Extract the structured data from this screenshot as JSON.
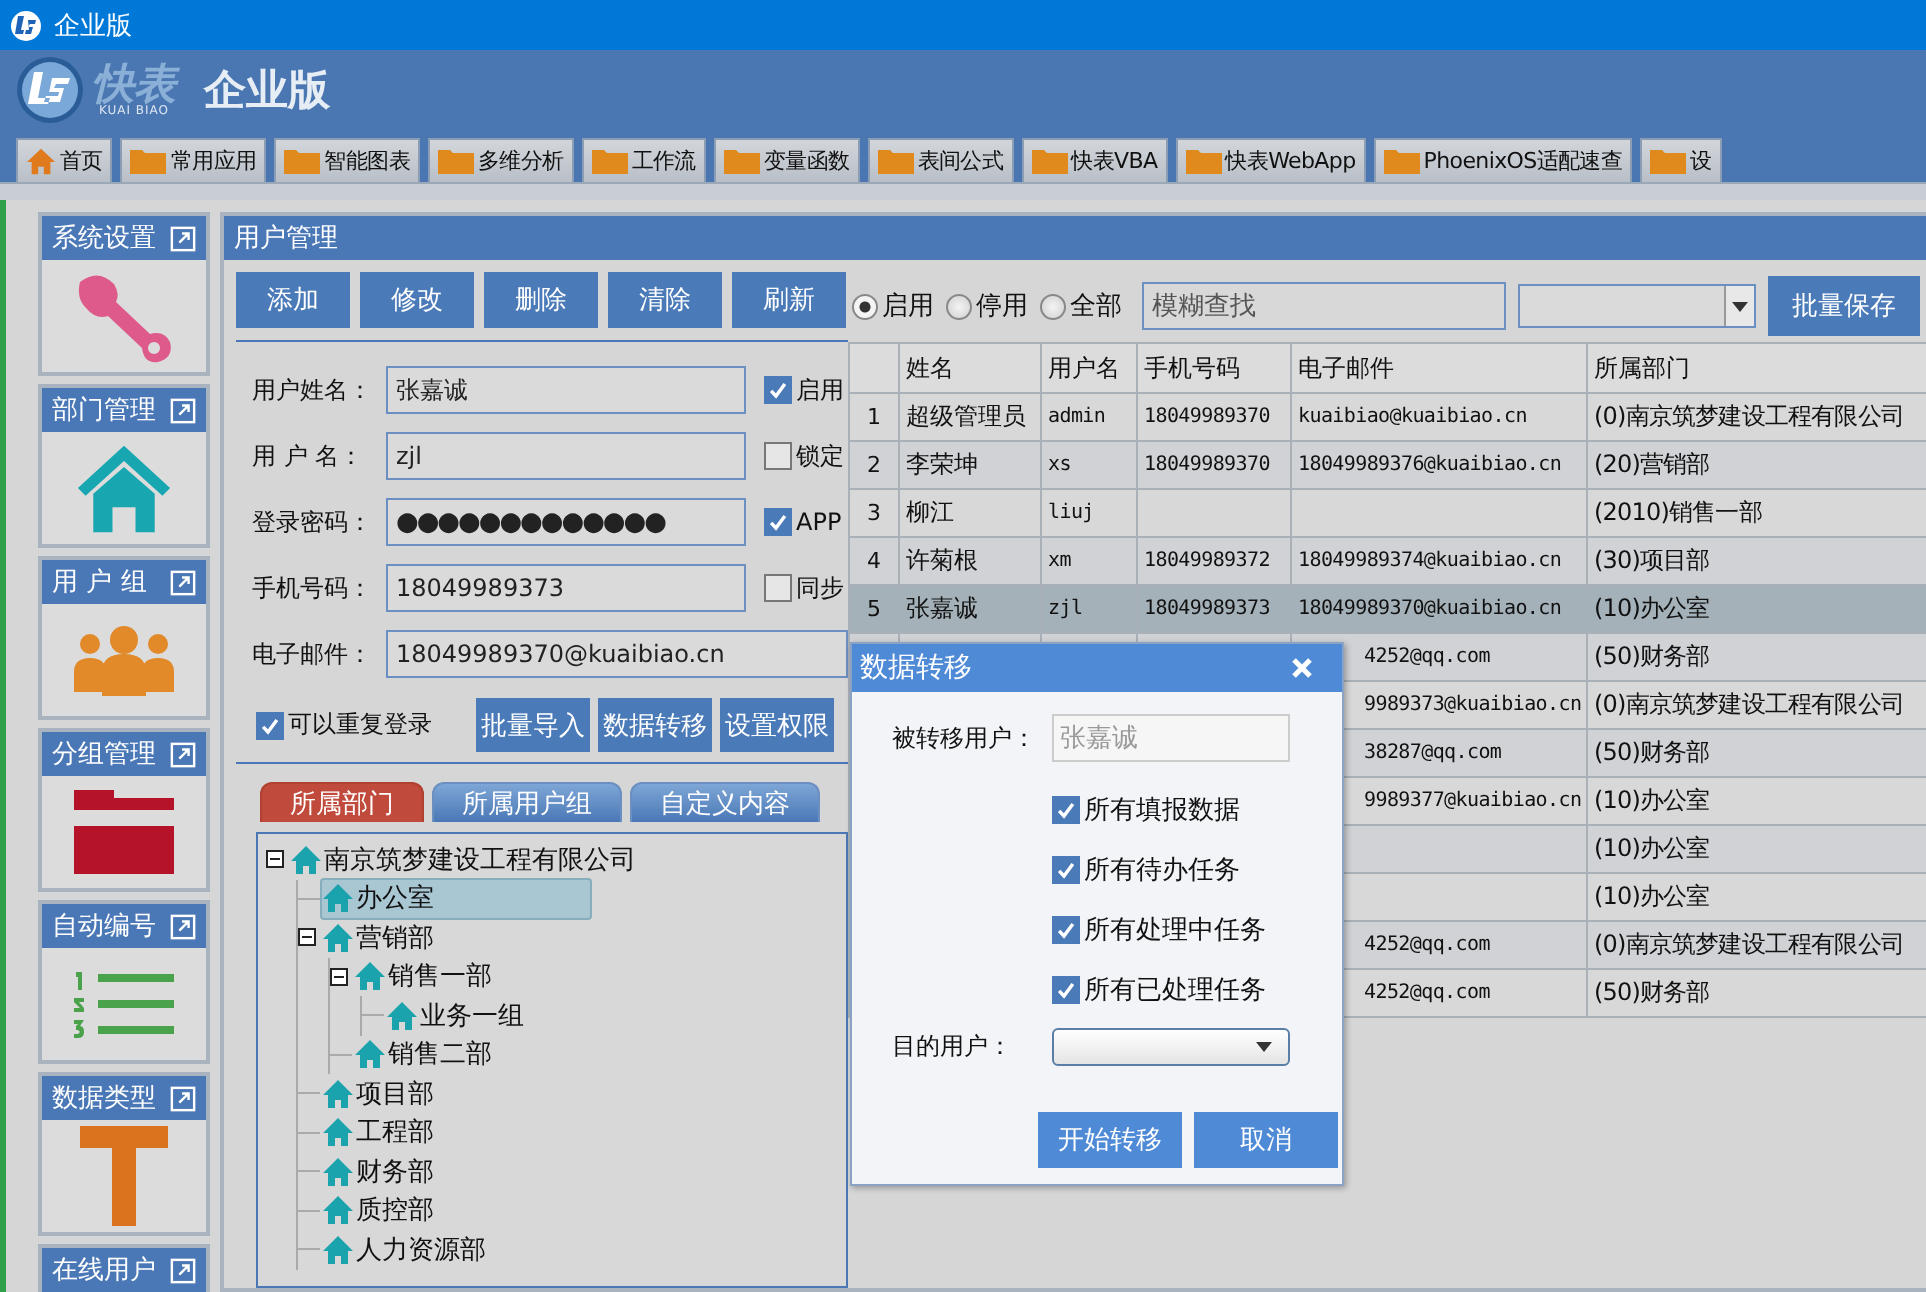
{
  "title_bar": {
    "title": "企业版"
  },
  "header": {
    "logo_text": "快表",
    "logo_subtext": "KUAI BIAO",
    "edition": "企业版"
  },
  "nav_tabs": [
    {
      "label": "首页",
      "kind": "home"
    },
    {
      "label": "常用应用",
      "kind": "folder"
    },
    {
      "label": "智能图表",
      "kind": "folder"
    },
    {
      "label": "多维分析",
      "kind": "folder"
    },
    {
      "label": "工作流",
      "kind": "folder"
    },
    {
      "label": "变量函数",
      "kind": "folder"
    },
    {
      "label": "表间公式",
      "kind": "folder"
    },
    {
      "label": "快表VBA",
      "kind": "folder"
    },
    {
      "label": "快表WebApp",
      "kind": "folder"
    },
    {
      "label": "PhoenixOS适配速查",
      "kind": "folder"
    },
    {
      "label": "设",
      "kind": "folder"
    }
  ],
  "sidebar": [
    {
      "title": "系统设置",
      "kind": "wrench"
    },
    {
      "title": "部门管理",
      "kind": "house"
    },
    {
      "title": "用 户 组",
      "kind": "people"
    },
    {
      "title": "分组管理",
      "kind": "folder"
    },
    {
      "title": "自动编号",
      "kind": "list"
    },
    {
      "title": "数据类型",
      "kind": "type"
    },
    {
      "title": "在线用户",
      "kind": "none"
    }
  ],
  "main": {
    "title": "用户管理",
    "toolbar": [
      "添加",
      "修改",
      "删除",
      "清除",
      "刷新"
    ],
    "fields": [
      {
        "label": "用户姓名：",
        "value": "张嘉诚",
        "option": {
          "label": "启用",
          "checked": true
        }
      },
      {
        "label": "用 户 名：",
        "value": "zjl",
        "option": {
          "label": "锁定",
          "checked": false
        }
      },
      {
        "label": "登录密码：",
        "value": "●●●●●●●●●●●●●",
        "option": {
          "label": "APP",
          "checked": true
        }
      },
      {
        "label": "手机号码：",
        "value": "18049989373",
        "option": {
          "label": "同步",
          "checked": false
        }
      },
      {
        "label": "电子邮件：",
        "value": "18049989370@kuaibiao.cn"
      }
    ],
    "repeat_login": {
      "label": "可以重复登录",
      "checked": true
    },
    "actions": [
      "批量导入",
      "数据转移",
      "设置权限"
    ],
    "tabs": [
      {
        "label": "所属部门",
        "selected": true
      },
      {
        "label": "所属用户组",
        "selected": false
      },
      {
        "label": "自定义内容",
        "selected": false
      }
    ],
    "tree": [
      {
        "label": "南京筑梦建设工程有限公司",
        "selected": false,
        "expanded": true,
        "children": [
          {
            "label": "办公室",
            "selected": true
          },
          {
            "label": "营销部",
            "selected": false,
            "expanded": true,
            "children": [
              {
                "label": "销售一部",
                "selected": false,
                "expanded": true,
                "children": [
                  {
                    "label": "业务一组",
                    "selected": false
                  }
                ]
              },
              {
                "label": "销售二部",
                "selected": false
              }
            ]
          },
          {
            "label": "项目部",
            "selected": false
          },
          {
            "label": "工程部",
            "selected": false
          },
          {
            "label": "财务部",
            "selected": false
          },
          {
            "label": "质控部",
            "selected": false
          },
          {
            "label": "人力资源部",
            "selected": false
          }
        ]
      }
    ]
  },
  "filter": {
    "radios": [
      {
        "label": "启用",
        "selected": true
      },
      {
        "label": "停用",
        "selected": false
      },
      {
        "label": "全部",
        "selected": false
      }
    ],
    "search": {
      "placeholder": "模糊查找"
    },
    "save_button": "批量保存"
  },
  "table": {
    "columns": [
      "姓名",
      "用户名",
      "手机号码",
      "电子邮件",
      "所属部门"
    ],
    "rows": [
      {
        "num": "1",
        "name": "超级管理员",
        "username": "admin",
        "phone": "18049989370",
        "email": "kuaibiao@kuaibiao.cn",
        "dept": "(0)南京筑梦建设工程有限公司",
        "selected": false
      },
      {
        "num": "2",
        "name": "李荣坤",
        "username": "xs",
        "phone": "18049989370",
        "email": "18049989376@kuaibiao.cn",
        "dept": "(20)营销部",
        "selected": false
      },
      {
        "num": "3",
        "name": "柳江",
        "username": "liuj",
        "phone": "",
        "email": "",
        "dept": "(2010)销售一部",
        "selected": false
      },
      {
        "num": "4",
        "name": "许菊根",
        "username": "xm",
        "phone": "18049989372",
        "email": "18049989374@kuaibiao.cn",
        "dept": "(30)项目部",
        "selected": false
      },
      {
        "num": "5",
        "name": "张嘉诚",
        "username": "zjl",
        "phone": "18049989373",
        "email": "18049989370@kuaibiao.cn",
        "dept": "(10)办公室",
        "selected": true
      },
      {
        "email": "4252@qq.com",
        "dept": "(50)财务部",
        "selected": false
      },
      {
        "email": "9989373@kuaibiao.cn",
        "dept": "(0)南京筑梦建设工程有限公司",
        "selected": false
      },
      {
        "email": "38287@qq.com",
        "dept": "(50)财务部",
        "selected": false
      },
      {
        "email": "9989377@kuaibiao.cn",
        "dept": "(10)办公室",
        "selected": false
      },
      {
        "email": "",
        "dept": "(10)办公室",
        "selected": false
      },
      {
        "email": "",
        "dept": "(10)办公室",
        "selected": false
      },
      {
        "email": "4252@qq.com",
        "dept": "(0)南京筑梦建设工程有限公司",
        "selected": false
      },
      {
        "email": "4252@qq.com",
        "dept": "(50)财务部",
        "selected": false
      }
    ]
  },
  "dialog": {
    "title": "数据转移",
    "source_label": "被转移用户：",
    "source_value": "张嘉诚",
    "options": [
      {
        "label": "所有填报数据",
        "checked": true
      },
      {
        "label": "所有待办任务",
        "checked": true
      },
      {
        "label": "所有处理中任务",
        "checked": true
      },
      {
        "label": "所有已处理任务",
        "checked": true
      }
    ],
    "target_label": "目的用户：",
    "buttons": [
      "开始转移",
      "取消"
    ]
  }
}
